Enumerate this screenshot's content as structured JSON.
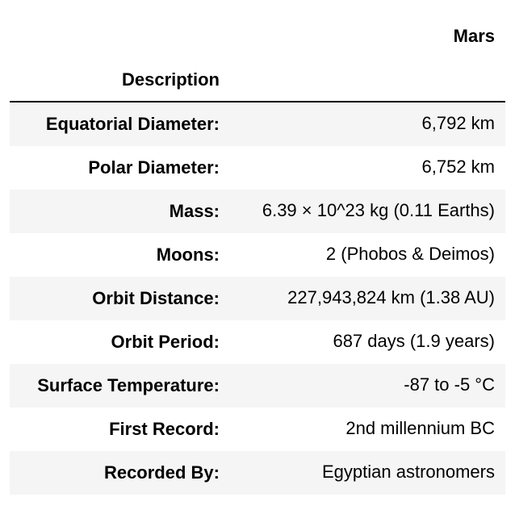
{
  "table": {
    "column_header": "Mars",
    "index_name": "Description",
    "rows": [
      {
        "label": "Equatorial Diameter:",
        "value": "6,792 km"
      },
      {
        "label": "Polar Diameter:",
        "value": "6,752 km"
      },
      {
        "label": "Mass:",
        "value": "6.39 × 10^23 kg (0.11 Earths)"
      },
      {
        "label": "Moons:",
        "value": "2 (Phobos & Deimos)"
      },
      {
        "label": "Orbit Distance:",
        "value": "227,943,824 km (1.38 AU)"
      },
      {
        "label": "Orbit Period:",
        "value": "687 days (1.9 years)"
      },
      {
        "label": "Surface Temperature:",
        "value": "-87 to -5 °C"
      },
      {
        "label": "First Record:",
        "value": "2nd millennium BC"
      },
      {
        "label": "Recorded By:",
        "value": "Egyptian astronomers"
      }
    ]
  },
  "colors": {
    "stripe": "#f5f5f5",
    "background": "#ffffff",
    "text": "#000000",
    "rule": "#000000"
  }
}
